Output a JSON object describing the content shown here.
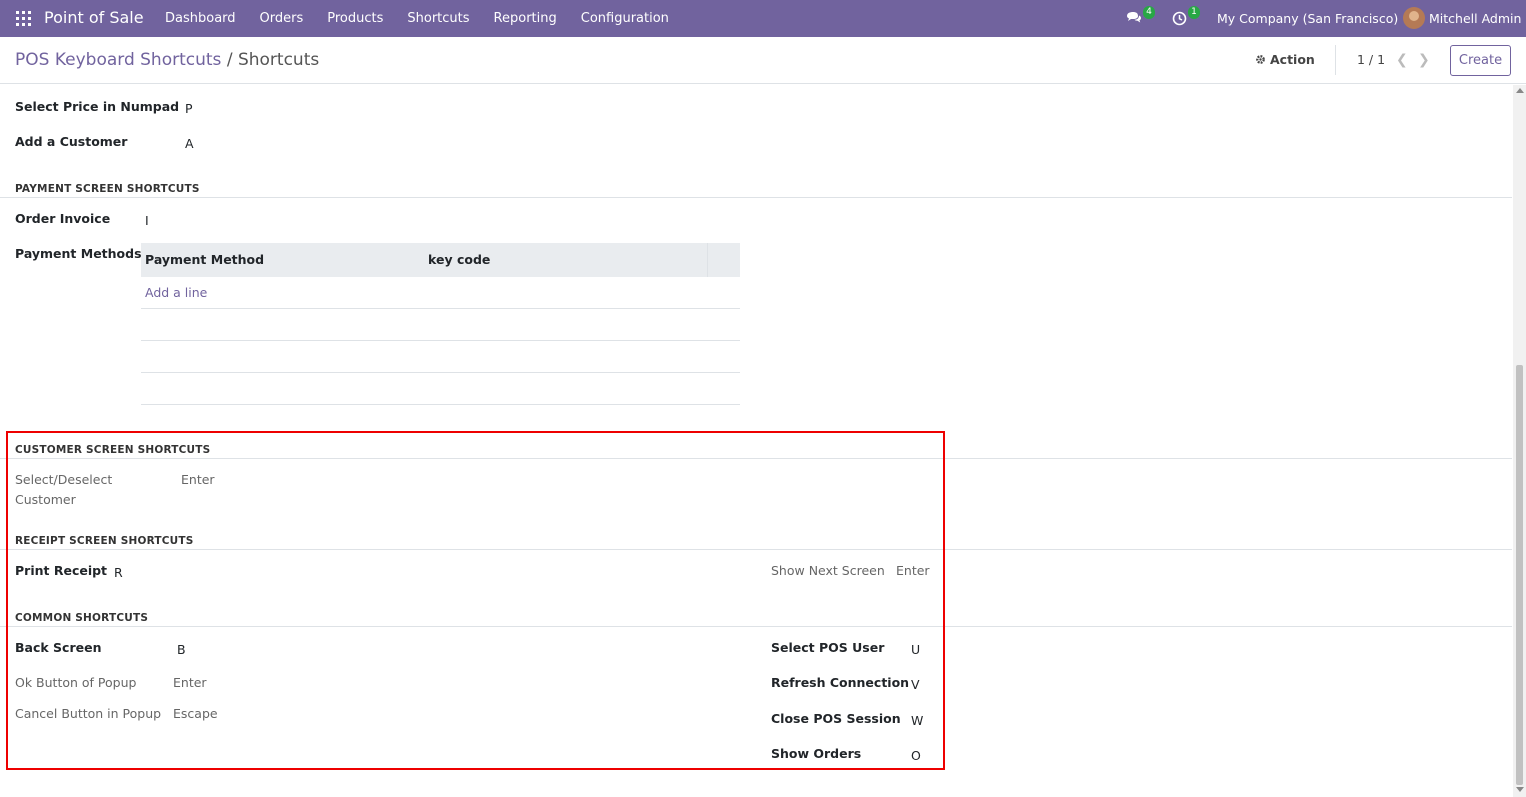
{
  "navbar": {
    "brand": "Point of Sale",
    "menu": [
      "Dashboard",
      "Orders",
      "Products",
      "Shortcuts",
      "Reporting",
      "Configuration"
    ],
    "messages_count": "4",
    "activities_count": "1",
    "company": "My Company (San Francisco)",
    "user": "Mitchell Admin",
    "accent_color": "#71639e"
  },
  "control_panel": {
    "breadcrumb_parent": "POS Keyboard Shortcuts",
    "breadcrumb_separator": "/",
    "breadcrumb_current": "Shortcuts",
    "action_label": "Action",
    "pager": "1 / 1",
    "create_label": "Create"
  },
  "form": {
    "select_price_label": "Select Price in Numpad",
    "select_price_value": "P",
    "add_customer_label": "Add a Customer",
    "add_customer_value": "A",
    "payment_section": "PAYMENT SCREEN SHORTCUTS",
    "order_invoice_label": "Order Invoice",
    "order_invoice_value": "I",
    "payment_methods_label": "Payment Methods",
    "payment_table": {
      "columns": [
        "Payment Method",
        "key code"
      ],
      "add_line": "Add a line"
    },
    "customer_section": "CUSTOMER SCREEN SHORTCUTS",
    "select_deselect_label_line1": "Select/Deselect",
    "select_deselect_label_line2": "Customer",
    "select_deselect_value": "Enter",
    "receipt_section": "RECEIPT SCREEN SHORTCUTS",
    "print_receipt_label": "Print Receipt",
    "print_receipt_value": "R",
    "show_next_screen_label": "Show Next Screen",
    "show_next_screen_value": "Enter",
    "common_section": "COMMON SHORTCUTS",
    "back_screen_label": "Back Screen",
    "back_screen_value": "B",
    "ok_popup_label": "Ok Button of Popup",
    "ok_popup_value": "Enter",
    "cancel_popup_label": "Cancel Button in Popup",
    "cancel_popup_value": "Escape",
    "select_pos_user_label": "Select POS User",
    "select_pos_user_value": "U",
    "refresh_connection_label": "Refresh Connection",
    "refresh_connection_value": "V",
    "close_pos_session_label": "Close POS Session",
    "close_pos_session_value": "W",
    "show_orders_label": "Show Orders",
    "show_orders_value": "O"
  },
  "highlight_color": "#e00000"
}
